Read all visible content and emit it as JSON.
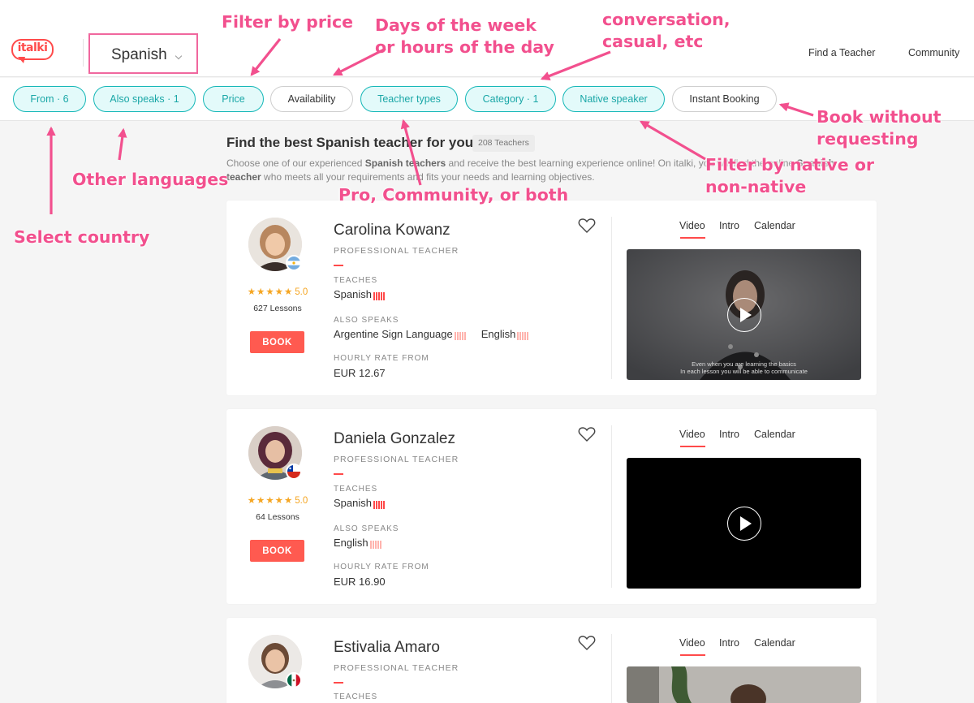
{
  "header": {
    "logo_text": "italki",
    "language_select": "Spanish",
    "nav": [
      "Find a Teacher",
      "Community"
    ]
  },
  "filters": [
    {
      "label": "From · 6",
      "active": true
    },
    {
      "label": "Also speaks · 1",
      "active": true
    },
    {
      "label": "Price",
      "active": true
    },
    {
      "label": "Availability",
      "active": false
    },
    {
      "label": "Teacher types",
      "active": true
    },
    {
      "label": "Category · 1",
      "active": true
    },
    {
      "label": "Native speaker",
      "active": true
    },
    {
      "label": "Instant Booking",
      "active": false
    }
  ],
  "main": {
    "heading": "Find the best Spanish teacher for you.",
    "count": "208 Teachers",
    "intro_1": "Choose one of our experienced ",
    "intro_b1": "Spanish teachers",
    "intro_2": " and receive the best learning experience online! On italki, you will find the online ",
    "intro_b2": "Spanish teacher",
    "intro_3": " who meets all your requirements and fits your needs and learning objectives."
  },
  "labels": {
    "role": "PROFESSIONAL TEACHER",
    "teaches": "TEACHES",
    "also_speaks": "ALSO SPEAKS",
    "rate": "HOURLY RATE FROM",
    "book": "BOOK",
    "stars": "★★★★★",
    "tabs": [
      "Video",
      "Intro",
      "Calendar"
    ]
  },
  "teachers": [
    {
      "name": "Carolina Kowanz",
      "rating": "5.0",
      "lessons": "627 Lessons",
      "teaches": "Spanish",
      "also_speaks_1": "Argentine Sign Language",
      "also_speaks_2": "English",
      "rate": "EUR 12.67",
      "video_caption_1": "Even when you are learning the basics",
      "video_caption_2": "In each lesson you will be able to communicate"
    },
    {
      "name": "Daniela Gonzalez",
      "rating": "5.0",
      "lessons": "64 Lessons",
      "teaches": "Spanish",
      "also_speaks_1": "English",
      "rate": "EUR 16.90"
    },
    {
      "name": "Estivalia Amaro",
      "teaches_label": "TEACHES"
    }
  ],
  "annotations": {
    "filter_price": "Filter by price",
    "days": [
      "Days of the week",
      "or hours of the day"
    ],
    "conversation": [
      "conversation,",
      "casual, etc"
    ],
    "book_without": [
      "Book without",
      "requesting"
    ],
    "other_languages": "Other languages",
    "select_country": "Select country",
    "pro_community": "Pro, Community, or both",
    "native_filter": [
      "Filter by native or",
      "non-native"
    ]
  },
  "colors": {
    "accent_red": "#ff4a4a",
    "teal": "#17b8b8",
    "annotation_pink": "#f2508e",
    "star": "#f5a623"
  }
}
